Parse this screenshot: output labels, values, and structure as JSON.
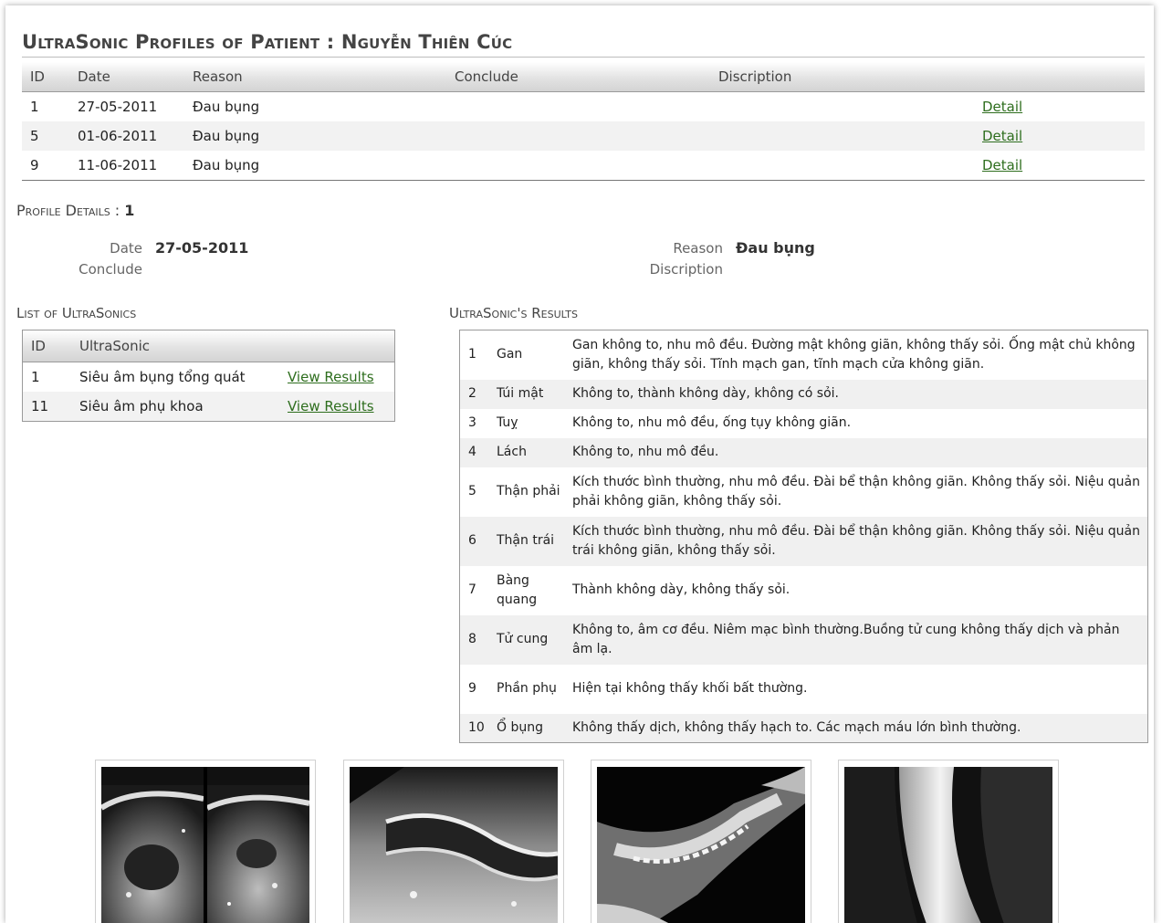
{
  "header": {
    "title": "UltraSonic Profiles of Patient : Nguyễn Thiên Cúc"
  },
  "profiles": {
    "columns": [
      "ID",
      "Date",
      "Reason",
      "Conclude",
      "Discription",
      ""
    ],
    "rows": [
      {
        "id": "1",
        "date": "27-05-2011",
        "reason": "Đau bụng",
        "conclude": "",
        "description": "",
        "link": "Detail"
      },
      {
        "id": "5",
        "date": "01-06-2011",
        "reason": "Đau bụng",
        "conclude": "",
        "description": "",
        "link": "Detail"
      },
      {
        "id": "9",
        "date": "11-06-2011",
        "reason": "Đau bụng",
        "conclude": "",
        "description": "",
        "link": "Detail"
      }
    ]
  },
  "details": {
    "heading": "Profile Details : ",
    "id": "1",
    "date_label": "Date",
    "date_value": "27-05-2011",
    "conclude_label": "Conclude",
    "conclude_value": "",
    "reason_label": "Reason",
    "reason_value": "Đau bụng",
    "description_label": "Discription",
    "description_value": ""
  },
  "ultrasonics": {
    "heading": "List of UltraSonics",
    "columns": [
      "ID",
      "UltraSonic",
      ""
    ],
    "rows": [
      {
        "id": "1",
        "name": "Siêu âm bụng tổng quát",
        "link": "View Results"
      },
      {
        "id": "11",
        "name": "Siêu âm phụ khoa",
        "link": "View Results"
      }
    ]
  },
  "results": {
    "heading": "UltraSonic's Results",
    "rows": [
      {
        "no": "1",
        "organ": "Gan",
        "text": "Gan không to, nhu mô đều. Đường mật không giãn, không thấy sỏi. Ống mật chủ không giãn, không thấy sỏi. Tĩnh mạch gan, tĩnh mạch cửa không giãn."
      },
      {
        "no": "2",
        "organ": "Túi mật",
        "text": "Không to, thành không dày, không có sỏi."
      },
      {
        "no": "3",
        "organ": "Tuỵ",
        "text": "Không to, nhu mô đều, ống tụy không giãn."
      },
      {
        "no": "4",
        "organ": "Lách",
        "text": "Không to, nhu mô đều."
      },
      {
        "no": "5",
        "organ": "Thận phải",
        "text": "Kích thước bình thường, nhu mô đều. Đài bể thận không giãn. Không thấy sỏi. Niệu quản phải không giãn, không thấy sỏi."
      },
      {
        "no": "6",
        "organ": "Thận trái",
        "text": "Kích thước bình thường, nhu mô đều. Đài bể thận không giãn. Không thấy sỏi. Niệu quản trái không giãn, không thấy sỏi."
      },
      {
        "no": "7",
        "organ": "Bàng quang",
        "text": "Thành không dày, không thấy sỏi."
      },
      {
        "no": "8",
        "organ": "Tử cung",
        "text": "Không to, âm cơ đều. Niêm mạc bình thường.Buồng tử cung không thấy dịch và phản âm lạ."
      },
      {
        "no": "9",
        "organ": "Phần phụ",
        "text": "Hiện tại không thấy khối bất thường."
      },
      {
        "no": "10",
        "organ": "Ổ bụng",
        "text": "Không thấy dịch, không thấy hạch to. Các mạch máu lớn bình thường."
      }
    ]
  },
  "images": [
    {
      "kind": "ultrasound-image"
    },
    {
      "kind": "ultrasound-image"
    },
    {
      "kind": "xray-image"
    },
    {
      "kind": "xray-image"
    }
  ]
}
